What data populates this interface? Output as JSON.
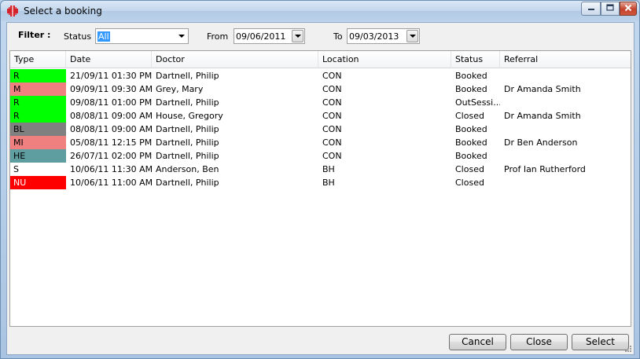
{
  "window": {
    "title": "Select a booking"
  },
  "filter": {
    "heading": "Filter :",
    "status_label": "Status",
    "status_value": "All",
    "from_label": "From",
    "from_value": "09/06/2011",
    "to_label": "To",
    "to_value": "09/03/2013"
  },
  "grid": {
    "columns": [
      "Type",
      "Date",
      "Doctor",
      "Location",
      "Status",
      "Referral"
    ],
    "rows": [
      {
        "type": "R",
        "type_color": "#00ff00",
        "date": "21/09/11 01:30 PM",
        "doctor": "Dartnell, Philip",
        "location": "CON",
        "status": "Booked",
        "referral": ""
      },
      {
        "type": "M",
        "type_color": "#f08080",
        "date": "09/09/11 09:30 AM",
        "doctor": "Grey, Mary",
        "location": "CON",
        "status": "Booked",
        "referral": "Dr Amanda Smith"
      },
      {
        "type": "R",
        "type_color": "#00ff00",
        "date": "09/08/11 01:00 PM",
        "doctor": "Dartnell, Philip",
        "location": "CON",
        "status": "OutSessi...",
        "referral": ""
      },
      {
        "type": "R",
        "type_color": "#00ff00",
        "date": "08/08/11 09:00 AM",
        "doctor": "House, Gregory",
        "location": "CON",
        "status": "Closed",
        "referral": "Dr Amanda Smith"
      },
      {
        "type": "BL",
        "type_color": "#808080",
        "date": "08/08/11 09:00 AM",
        "doctor": "Dartnell, Philip",
        "location": "CON",
        "status": "Booked",
        "referral": ""
      },
      {
        "type": "MI",
        "type_color": "#f08080",
        "date": "05/08/11 12:15 PM",
        "doctor": "Dartnell, Philip",
        "location": "CON",
        "status": "Booked",
        "referral": "Dr Ben Anderson"
      },
      {
        "type": "HE",
        "type_color": "#5f9ea0",
        "date": "26/07/11 02:00 PM",
        "doctor": "Dartnell, Philip",
        "location": "CON",
        "status": "Booked",
        "referral": ""
      },
      {
        "type": "S",
        "type_color": "#ffffff",
        "date": "10/06/11 11:30 AM",
        "doctor": "Anderson, Ben",
        "location": "BH",
        "status": "Closed",
        "referral": "Prof Ian Rutherford"
      },
      {
        "type": "NU",
        "type_color": "#ff0000",
        "date": "10/06/11 11:00 AM",
        "doctor": "Dartnell, Philip",
        "location": "BH",
        "status": "Closed",
        "referral": "",
        "type_text_color": "#ffffff"
      }
    ]
  },
  "buttons": {
    "cancel": "Cancel",
    "close": "Close",
    "select": "Select"
  },
  "icons": {
    "app": "red-cross-icon",
    "minimize": "minimize-icon",
    "maximize": "maximize-icon",
    "close": "close-icon"
  }
}
